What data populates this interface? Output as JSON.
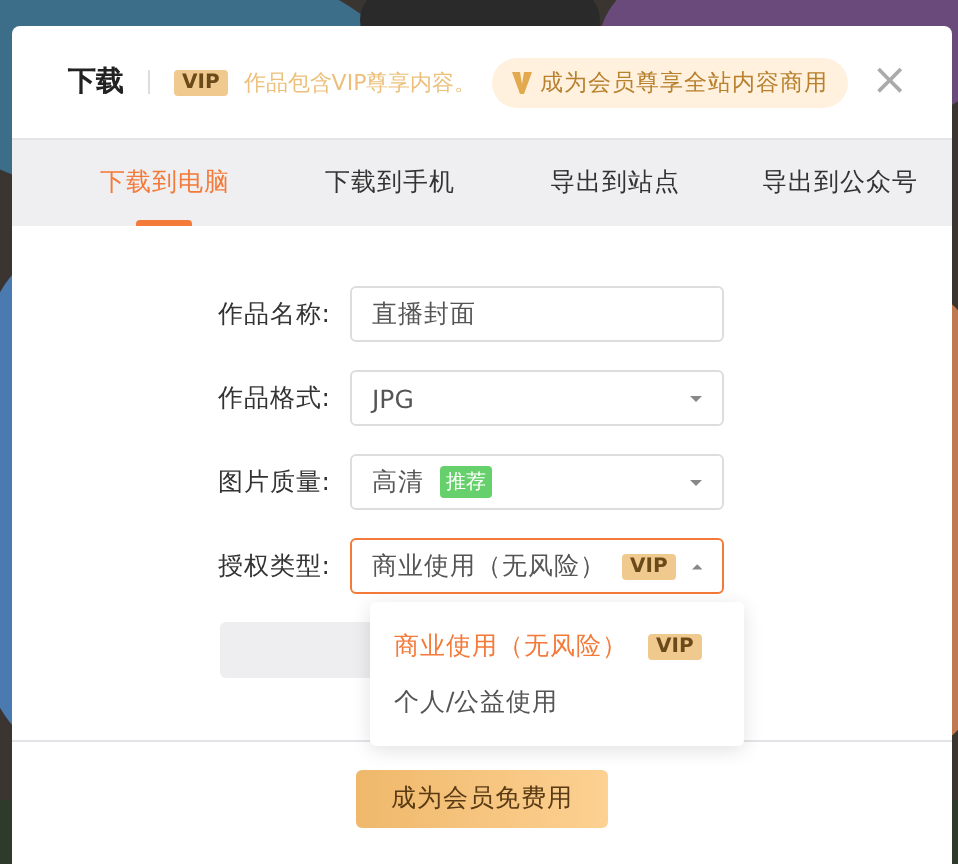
{
  "dialog": {
    "title": "下载",
    "vip_badge": "VIP",
    "vip_note": "作品包含VIP尊享内容。",
    "promo": "成为会员尊享全站内容商用",
    "close": "×"
  },
  "tabs": [
    {
      "label": "下载到电脑",
      "selected": true
    },
    {
      "label": "下载到手机",
      "selected": false
    },
    {
      "label": "导出到站点",
      "selected": false
    },
    {
      "label": "导出到公众号",
      "selected": false
    }
  ],
  "fields": [
    {
      "kind": "text",
      "label": "作品名称:",
      "value": "直播封面"
    },
    {
      "kind": "select",
      "label": "作品格式:",
      "value": "JPG",
      "expanded": false
    },
    {
      "kind": "select",
      "label": "图片质量:",
      "value": "高清",
      "tag": "推荐",
      "expanded": false
    },
    {
      "kind": "select",
      "label": "授权类型:",
      "value": "商业使用（无风险）",
      "vip": "VIP",
      "expanded": true,
      "options": [
        {
          "label": "商业使用（无风险）",
          "vip": "VIP",
          "selected": true
        },
        {
          "label": "个人/公益使用",
          "selected": false
        }
      ]
    }
  ],
  "footer_button": "成为会员免费用"
}
